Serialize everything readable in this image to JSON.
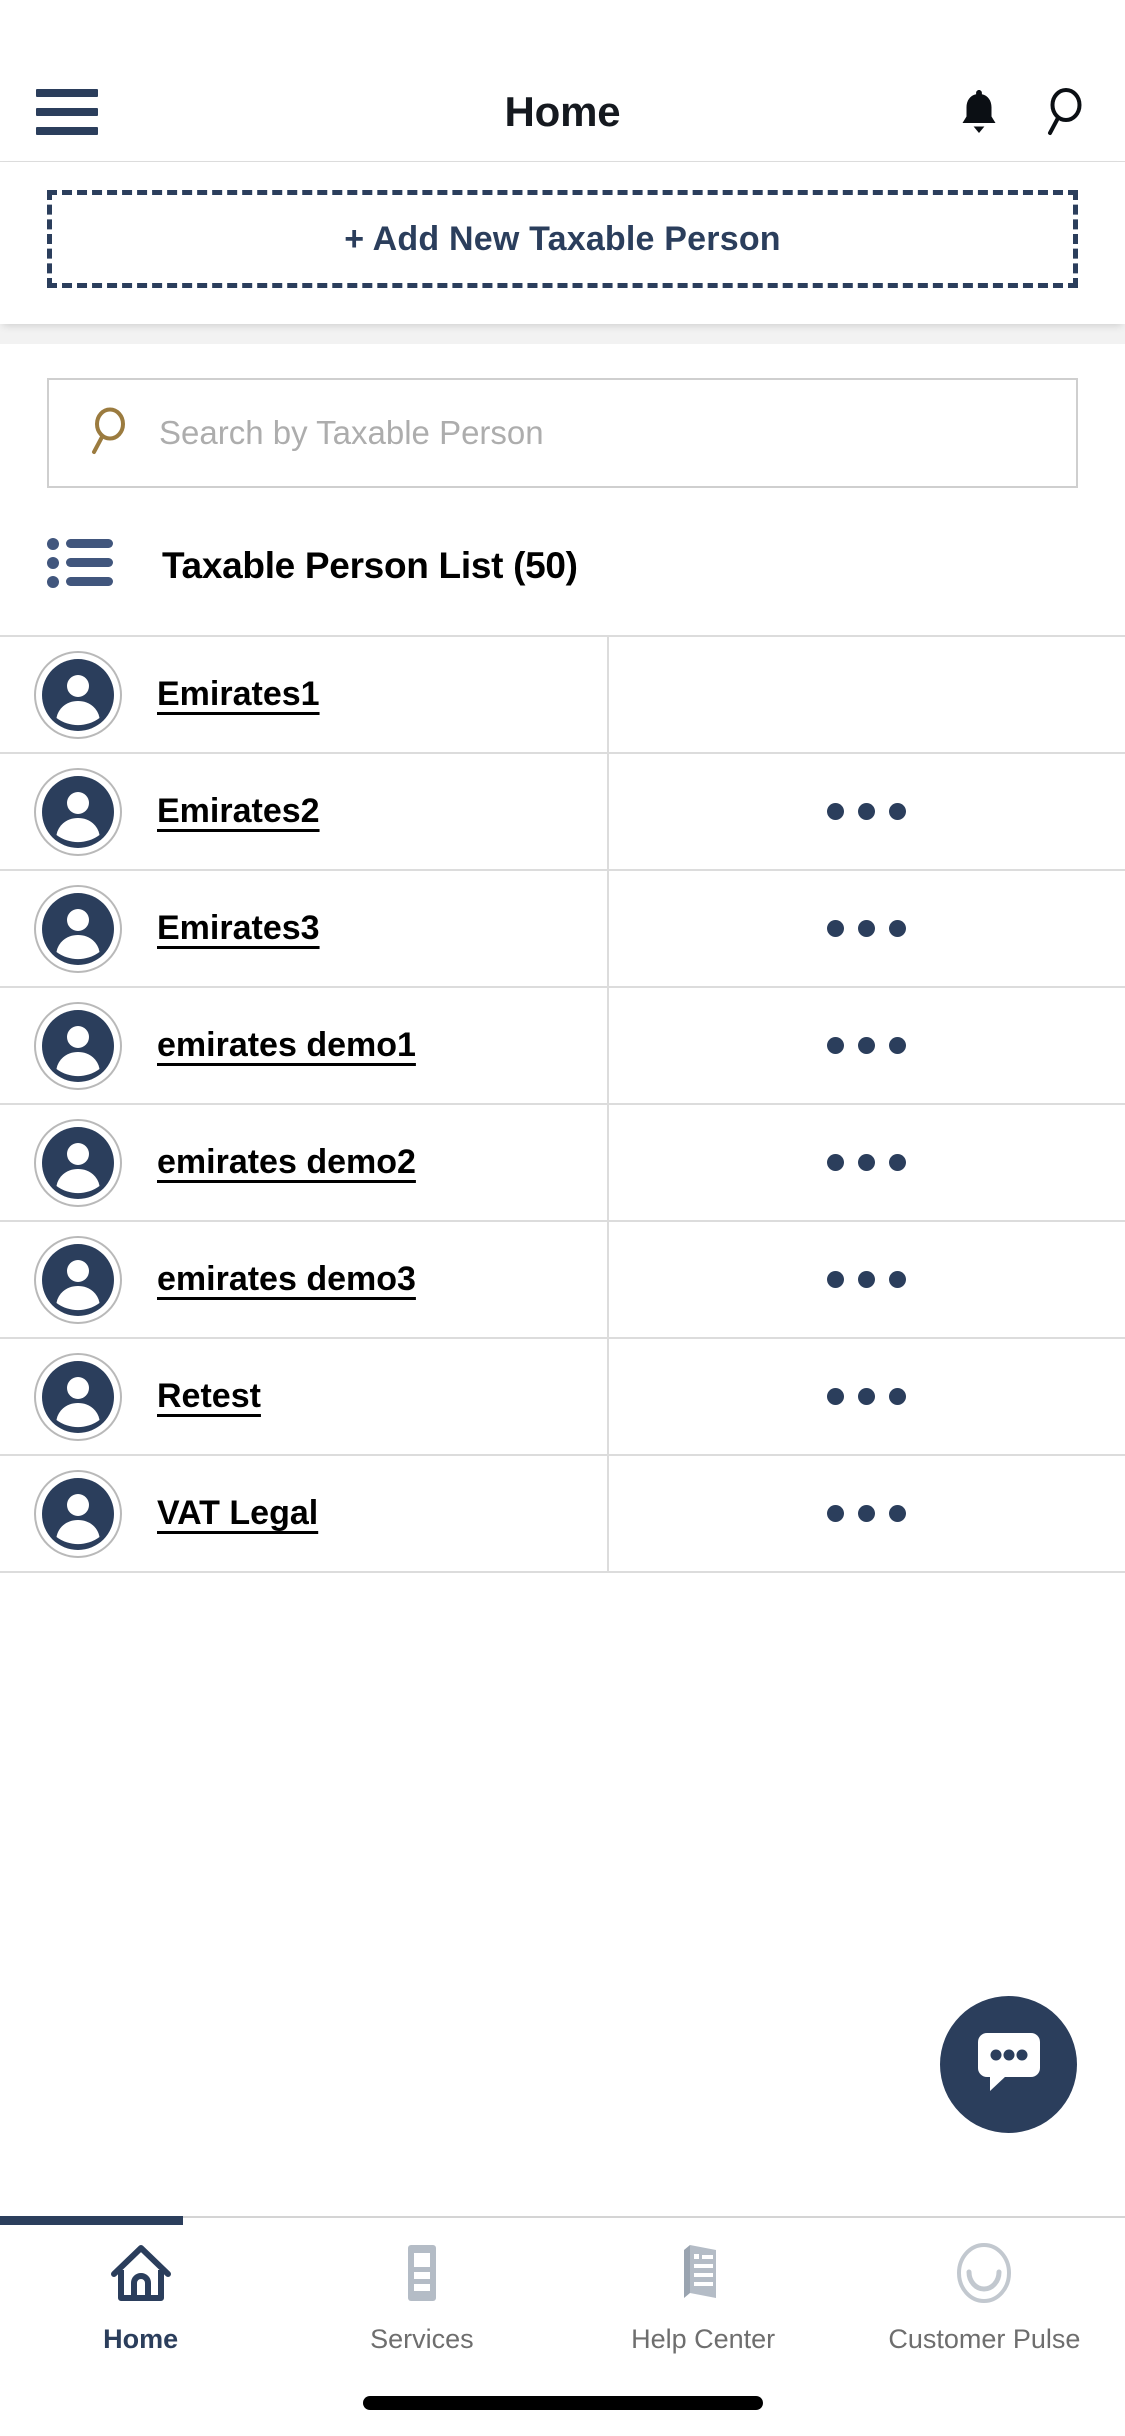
{
  "appbar": {
    "title": "Home",
    "menu_icon": "hamburger-menu-icon",
    "notifications_icon": "bell-icon",
    "search_icon": "search-icon"
  },
  "cta": {
    "label": "+ Add New Taxable Person"
  },
  "search": {
    "placeholder": "Search by Taxable Person",
    "value": "",
    "icon": "search-icon"
  },
  "list": {
    "icon": "bulleted-list-icon",
    "title": "Taxable Person List (50)",
    "count": 50,
    "rows": [
      {
        "name": "Emirates1",
        "avatar": "person-avatar-icon",
        "has_menu": false
      },
      {
        "name": "Emirates2",
        "avatar": "person-avatar-icon",
        "has_menu": true
      },
      {
        "name": "Emirates3",
        "avatar": "person-avatar-icon",
        "has_menu": true
      },
      {
        "name": "emirates demo1",
        "avatar": "person-avatar-icon",
        "has_menu": true
      },
      {
        "name": "emirates demo2",
        "avatar": "person-avatar-icon",
        "has_menu": true
      },
      {
        "name": "emirates demo3",
        "avatar": "person-avatar-icon",
        "has_menu": true
      },
      {
        "name": "Retest",
        "avatar": "person-avatar-icon",
        "has_menu": true
      },
      {
        "name": "VAT Legal",
        "avatar": "person-avatar-icon",
        "has_menu": true
      }
    ]
  },
  "fab": {
    "icon": "chat-bubble-icon",
    "label": "Chat"
  },
  "bottom_nav": {
    "items": [
      {
        "label": "Home",
        "icon": "home-icon",
        "active": true
      },
      {
        "label": "Services",
        "icon": "services-grid-icon",
        "active": false
      },
      {
        "label": "Help Center",
        "icon": "book-icon",
        "active": false
      },
      {
        "label": "Customer Pulse",
        "icon": "smiley-face-icon",
        "active": false
      }
    ]
  },
  "colors": {
    "navy": "#2b3e5c",
    "gold": "#9b7b3f",
    "placeholder_gray": "#adadad",
    "divider_gray": "#dcdcdc",
    "inactive_nav": "#6e6e6e"
  }
}
